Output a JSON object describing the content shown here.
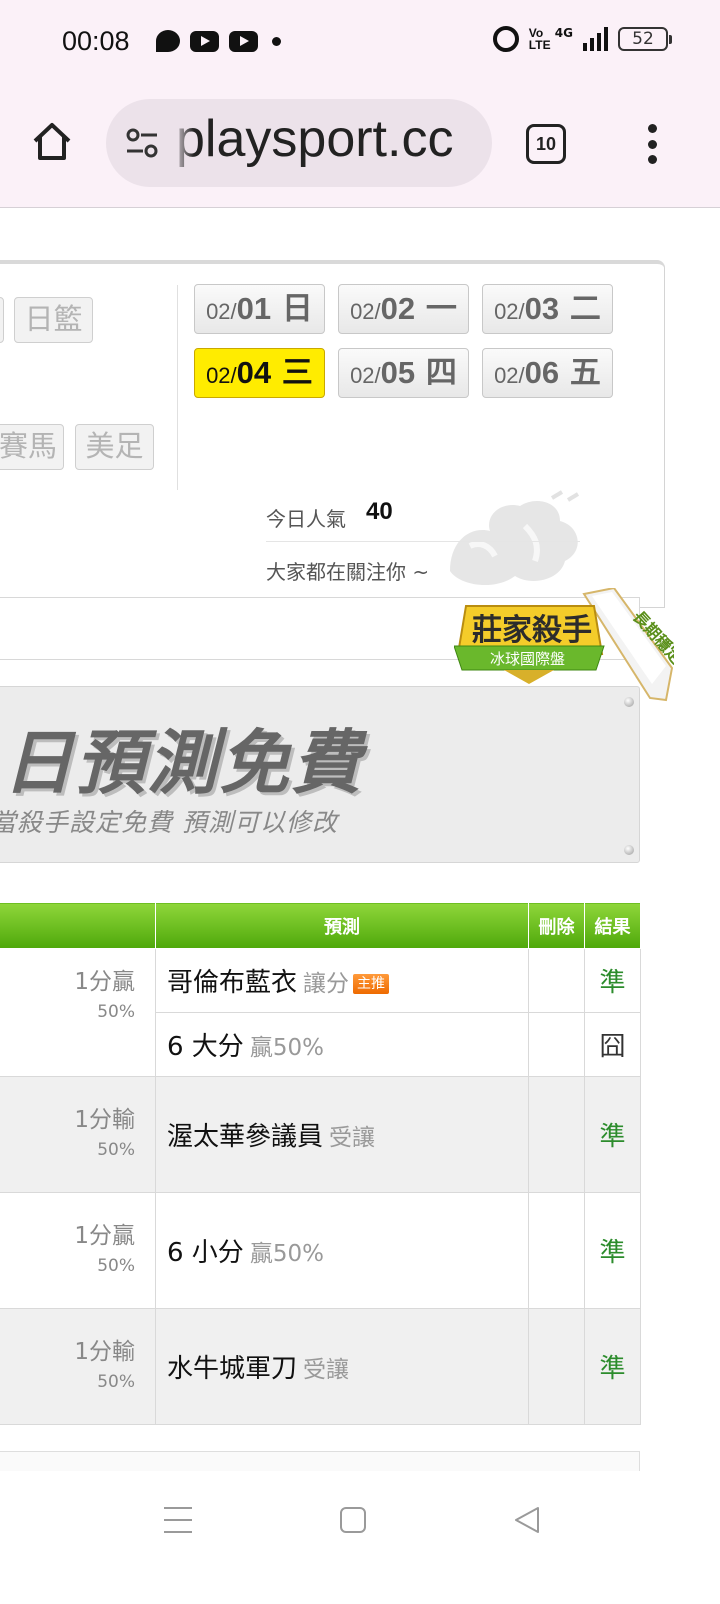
{
  "status_bar": {
    "time": "00:08",
    "volte": "Vo LTE",
    "network": "4G",
    "battery": "52"
  },
  "browser": {
    "url": "playsport.cc",
    "tab_count": "10"
  },
  "sports": {
    "row1": [
      "日籃"
    ],
    "row2": [
      "賽馬",
      "美足"
    ]
  },
  "dates": [
    {
      "md": "02/",
      "d": "01",
      "w": " 日",
      "active": false
    },
    {
      "md": "02/",
      "d": "02",
      "w": " 一",
      "active": false
    },
    {
      "md": "02/",
      "d": "03",
      "w": " 二",
      "active": false
    },
    {
      "md": "02/",
      "d": "04",
      "w": " 三",
      "active": true
    },
    {
      "md": "02/",
      "d": "05",
      "w": " 四",
      "active": false
    },
    {
      "md": "02/",
      "d": "06",
      "w": " 五",
      "active": false
    }
  ],
  "popularity": {
    "label": "今日人氣",
    "value": "40",
    "caption": "大家都在關注你 ~"
  },
  "badge": {
    "title": "莊家殺手",
    "subtitle": "冰球國際盤",
    "ribbon": "長期穩定"
  },
  "banner": {
    "title": "日預測免費",
    "subtitle": "當殺手設定免費 預測可以修改"
  },
  "table": {
    "headers": {
      "prediction": "預測",
      "delete": "刪除",
      "result": "結果"
    },
    "rows": [
      {
        "record": "1分贏",
        "pct": "50%",
        "team": "哥倫布藍衣",
        "note": "讓分",
        "tag": "主推",
        "result": "準",
        "alt": false
      },
      {
        "team": "6 大分",
        "note": "贏50%",
        "result": "囧",
        "alt": false
      },
      {
        "record": "1分輸",
        "pct": "50%",
        "team": "渥太華參議員",
        "note": "受讓",
        "result": "準",
        "alt": true
      },
      {
        "record": "1分贏",
        "pct": "50%",
        "team": "6 小分",
        "note": "贏50%",
        "result": "準",
        "alt": false
      },
      {
        "record": "1分輸",
        "pct": "50%",
        "team": "水牛城軍刀",
        "note": "受讓",
        "result": "準",
        "alt": true
      }
    ]
  }
}
